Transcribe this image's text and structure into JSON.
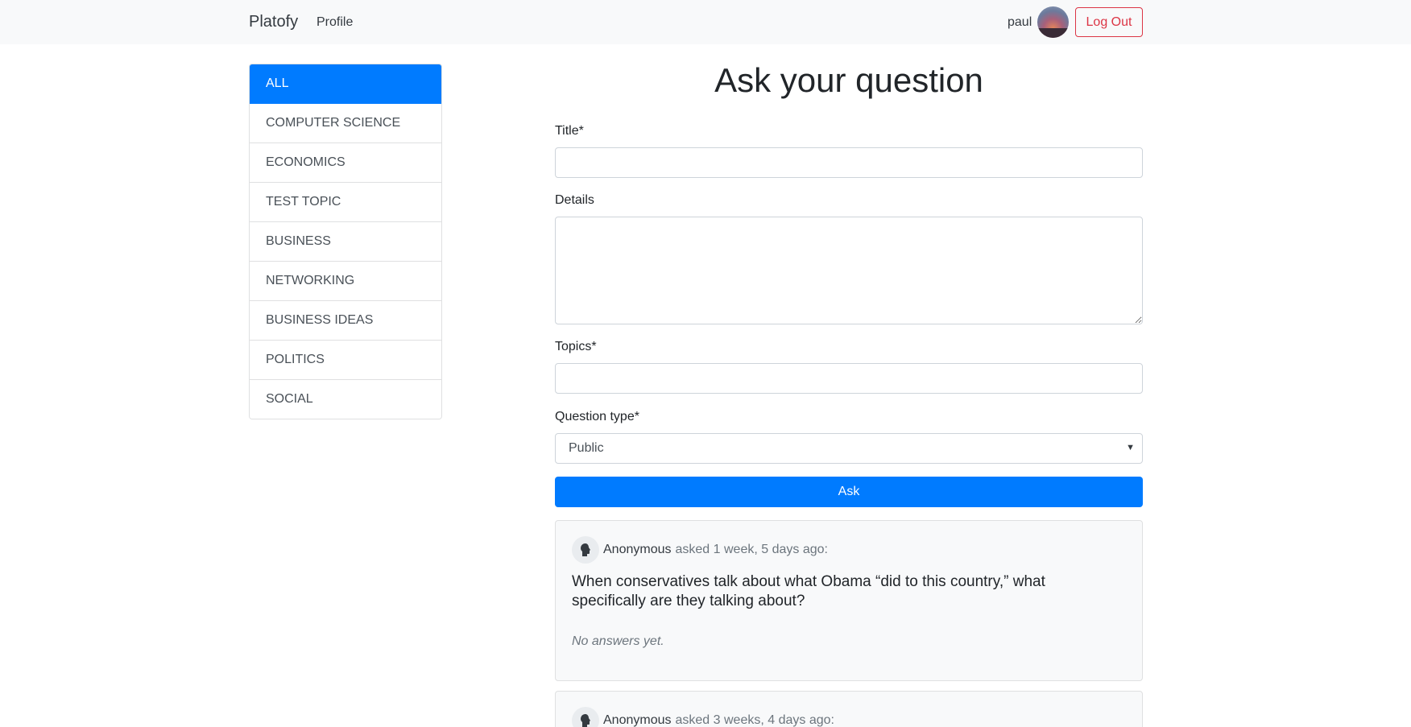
{
  "navbar": {
    "brand": "Platofy",
    "profile_link": "Profile",
    "username": "paul",
    "logout_label": "Log Out"
  },
  "sidebar": {
    "items": [
      {
        "label": "ALL",
        "active": true
      },
      {
        "label": "COMPUTER SCIENCE"
      },
      {
        "label": "ECONOMICS"
      },
      {
        "label": "TEST TOPIC"
      },
      {
        "label": "BUSINESS"
      },
      {
        "label": "NETWORKING"
      },
      {
        "label": "BUSINESS IDEAS"
      },
      {
        "label": "POLITICS"
      },
      {
        "label": "SOCIAL"
      }
    ]
  },
  "form": {
    "title": "Ask your question",
    "title_label": "Title*",
    "title_value": "",
    "details_label": "Details",
    "details_value": "",
    "topics_label": "Topics*",
    "topics_value": "",
    "type_label": "Question type*",
    "type_selected": "Public",
    "submit_label": "Ask"
  },
  "questions": [
    {
      "author": "Anonymous",
      "asked": "asked 1 week, 5 days ago:",
      "title": "When conservatives talk about what Obama “did to this country,” what specifically are they talking about?",
      "answers": "No answers yet."
    },
    {
      "author": "Anonymous",
      "asked": "asked 3 weeks, 4 days ago:"
    }
  ],
  "colors": {
    "primary": "#007bff",
    "danger": "#dc3545",
    "navbar_bg": "#f8f9fa"
  }
}
